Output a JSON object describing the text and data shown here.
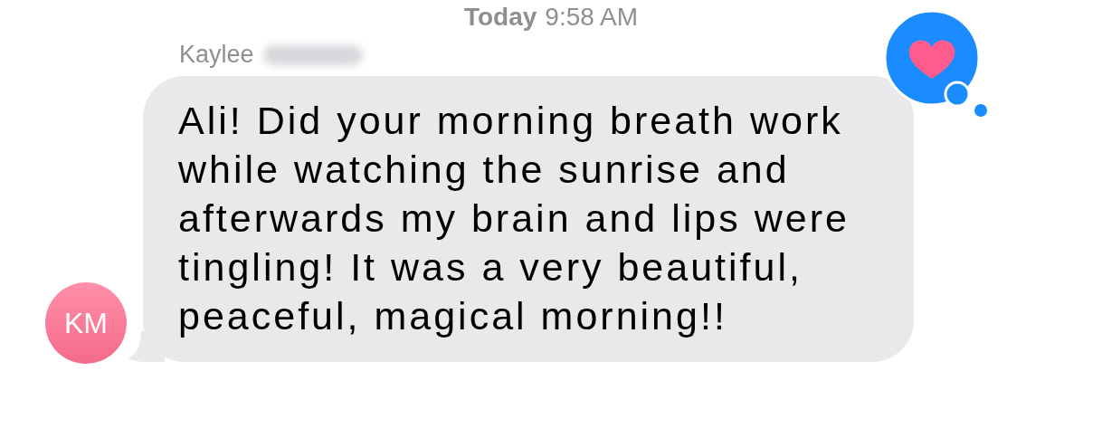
{
  "timestamp": {
    "day": "Today",
    "time": "9:58 AM"
  },
  "message": {
    "sender": "Kaylee",
    "sender_redacted": true,
    "initials": "KM",
    "text": "Ali! Did your morning breath work while watching the sunrise and afterwards my brain and lips were tingling! It was a very beautiful, peaceful, magical morning!!",
    "heart_reaction": true
  }
}
